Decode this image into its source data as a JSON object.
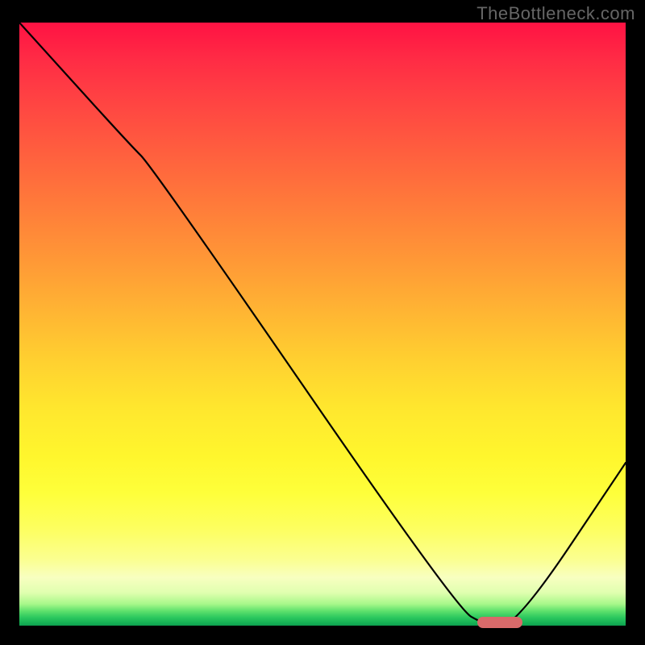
{
  "watermark": "TheBottleneck.com",
  "chart_data": {
    "type": "line",
    "title": "",
    "xlabel": "",
    "ylabel": "",
    "xlim": [
      0,
      100
    ],
    "ylim": [
      0,
      100
    ],
    "series": [
      {
        "name": "bottleneck-curve",
        "x": [
          0,
          18,
          22,
          72,
          77,
          82,
          100
        ],
        "values": [
          100,
          80,
          76,
          3,
          0,
          0,
          27
        ]
      }
    ],
    "annotations": [
      {
        "name": "optimal-marker",
        "x_start": 75.5,
        "x_end": 83,
        "y": 0.6
      }
    ],
    "background_gradient": {
      "direction": "top-to-bottom",
      "stops": [
        {
          "pos": 0,
          "color": "#ff1243"
        },
        {
          "pos": 0.5,
          "color": "#ffd030"
        },
        {
          "pos": 0.78,
          "color": "#feff3a"
        },
        {
          "pos": 1.0,
          "color": "#0ea050"
        }
      ]
    }
  }
}
